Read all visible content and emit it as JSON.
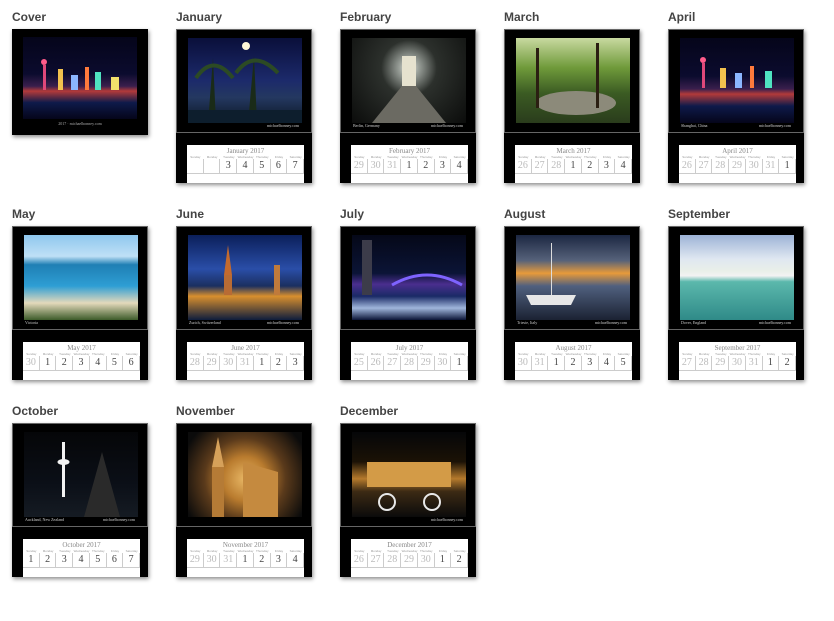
{
  "titles": {
    "cover": "Cover",
    "jan": "January",
    "feb": "February",
    "mar": "March",
    "apr": "April",
    "may": "May",
    "jun": "June",
    "jul": "July",
    "aug": "August",
    "sep": "September",
    "oct": "October",
    "nov": "November",
    "dec": "December"
  },
  "cover": {
    "year": "2017",
    "site": "michaelbonney.com"
  },
  "months": {
    "jan": {
      "cal_title": "January 2017",
      "caption": "",
      "site": "michaelbonney.com",
      "days": [
        "",
        "",
        "3",
        "4",
        "5",
        "6",
        "7"
      ]
    },
    "feb": {
      "cal_title": "February 2017",
      "caption": "Berlin, Germany",
      "site": "michaelbonney.com",
      "days": [
        "29",
        "30",
        "31",
        "1",
        "2",
        "3",
        "4"
      ]
    },
    "mar": {
      "cal_title": "March 2017",
      "caption": "",
      "site": "",
      "days": [
        "26",
        "27",
        "28",
        "1",
        "2",
        "3",
        "4"
      ]
    },
    "apr": {
      "cal_title": "April 2017",
      "caption": "Shanghai, China",
      "site": "michaelbonney.com",
      "days": [
        "26",
        "27",
        "28",
        "29",
        "30",
        "31",
        "1"
      ]
    },
    "may": {
      "cal_title": "May 2017",
      "caption": "Victoria",
      "site": "",
      "days": [
        "30",
        "1",
        "2",
        "3",
        "4",
        "5",
        "6"
      ]
    },
    "jun": {
      "cal_title": "June 2017",
      "caption": "Zurich, Switzerland",
      "site": "michaelbonney.com",
      "days": [
        "28",
        "29",
        "30",
        "31",
        "1",
        "2",
        "3"
      ]
    },
    "jul": {
      "cal_title": "July 2017",
      "caption": "",
      "site": "",
      "days": [
        "25",
        "26",
        "27",
        "28",
        "29",
        "30",
        "1"
      ]
    },
    "aug": {
      "cal_title": "August 2017",
      "caption": "Trieste, Italy",
      "site": "michaelbonney.com",
      "days": [
        "30",
        "31",
        "1",
        "2",
        "3",
        "4",
        "5"
      ]
    },
    "sep": {
      "cal_title": "September 2017",
      "caption": "Dover, England",
      "site": "michaelbonney.com",
      "days": [
        "27",
        "28",
        "29",
        "30",
        "31",
        "1",
        "2"
      ]
    },
    "oct": {
      "cal_title": "October 2017",
      "caption": "Auckland, New Zealand",
      "site": "michaelbonney.com",
      "days": [
        "1",
        "2",
        "3",
        "4",
        "5",
        "6",
        "7"
      ]
    },
    "nov": {
      "cal_title": "November 2017",
      "caption": "",
      "site": "",
      "days": [
        "29",
        "30",
        "31",
        "1",
        "2",
        "3",
        "4"
      ]
    },
    "dec": {
      "cal_title": "December 2017",
      "caption": "",
      "site": "michaelbonney.com",
      "days": [
        "26",
        "27",
        "28",
        "29",
        "30",
        "1",
        "2"
      ]
    }
  },
  "weekdays": [
    "Sunday",
    "Monday",
    "Tuesday",
    "Wednesday",
    "Thursday",
    "Friday",
    "Saturday"
  ],
  "icons": {
    "thumbnail": "calendar-thumbnail"
  }
}
